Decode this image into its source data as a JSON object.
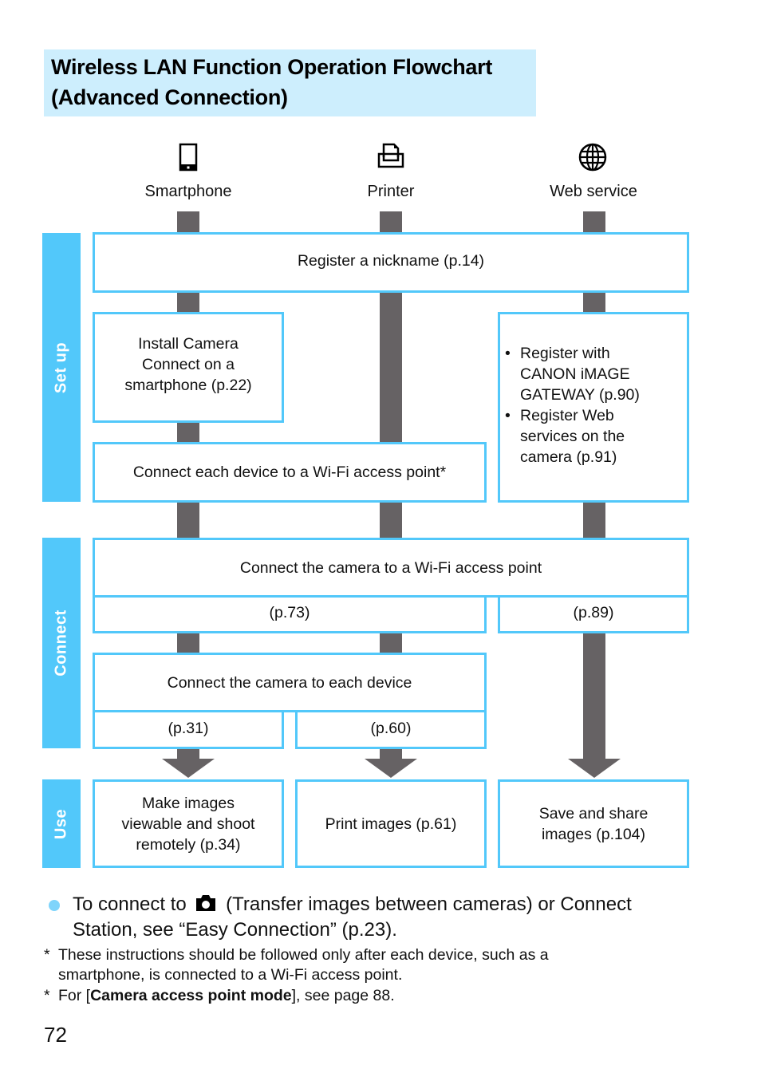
{
  "title": {
    "line1": "Wireless LAN Function Operation Flowchart",
    "line2": "(Advanced Connection)"
  },
  "columns": [
    {
      "label": "Smartphone",
      "icon": "smartphone-icon"
    },
    {
      "label": "Printer",
      "icon": "printer-icon"
    },
    {
      "label": "Web service",
      "icon": "globe-icon"
    }
  ],
  "phases": {
    "setup": "Set up",
    "connect": "Connect",
    "use": "Use"
  },
  "setup": {
    "register_nickname": "Register a nickname (p.14)",
    "install_camera_connect": [
      "Install Camera",
      "Connect on a",
      "smartphone (p.22)"
    ],
    "connect_each_device": "Connect each device to a Wi-Fi access point*",
    "web_service_items": [
      [
        "Register with",
        "CANON iMAGE",
        "GATEWAY (p.90)"
      ],
      [
        "Register Web",
        "services on the",
        "camera (p.91)"
      ]
    ]
  },
  "connect": {
    "camera_to_ap": "Connect the camera to a Wi-Fi access point",
    "camera_to_ap_page_left": "(p.73)",
    "camera_to_ap_page_right": "(p.89)",
    "camera_to_device": "Connect the camera to each device",
    "camera_to_device_page_smartphone": "(p.31)",
    "camera_to_device_page_printer": "(p.60)"
  },
  "use": {
    "smartphone": [
      "Make images",
      "viewable and shoot",
      "remotely (p.34)"
    ],
    "printer": "Print images (p.61)",
    "web_service": [
      "Save and share",
      "images (p.104)"
    ]
  },
  "notes": {
    "bullet_prefix": "To connect to",
    "bullet_icon": "camera-icon",
    "bullet_rest_line1": "(Transfer images between cameras) or Connect",
    "bullet_line2": "Station, see “Easy Connection” (p.23).",
    "footnote1_line1": "These instructions should be followed only after each device, such as a",
    "footnote1_line2": "smartphone, is connected to a Wi-Fi access point.",
    "footnote2_pre": "For [",
    "footnote2_bold": "Camera access point mode",
    "footnote2_post": "], see page 88.",
    "asterisk": "*"
  },
  "page_number": "72",
  "colors": {
    "accent_blue": "#52c8fa",
    "title_bg": "#cdeefd",
    "connector_gray": "#666264"
  }
}
